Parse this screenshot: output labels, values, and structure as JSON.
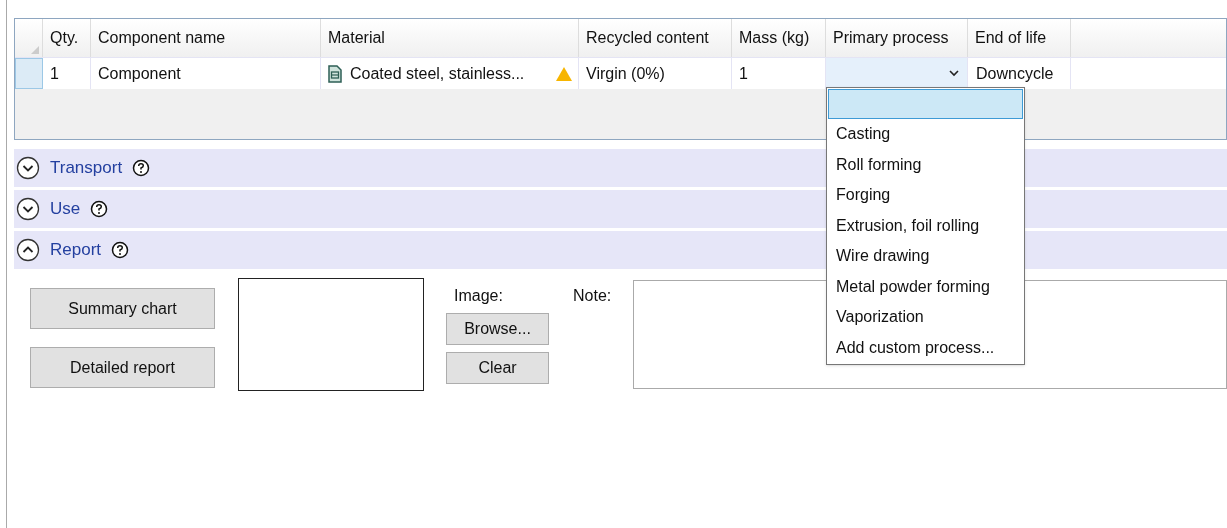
{
  "table": {
    "columns": [
      "Qty.",
      "Component name",
      "Material",
      "Recycled content",
      "Mass (kg)",
      "Primary process",
      "End of life"
    ],
    "rows": [
      {
        "selected": true,
        "qty": "1",
        "name": "Component",
        "material": "Coated steel, stainless...",
        "material_warning": true,
        "recycled": "Virgin (0%)",
        "mass": "1",
        "process": {
          "open": true
        },
        "end_of_life": "Downcycle"
      }
    ]
  },
  "process_dropdown": {
    "blank_option": {
      "selected": true
    },
    "options": [
      {
        "label": "Casting",
        "selected": false
      },
      {
        "label": "Roll forming",
        "selected": false
      },
      {
        "label": "Forging",
        "selected": false
      },
      {
        "label": "Extrusion, foil rolling",
        "selected": false
      },
      {
        "label": "Wire drawing",
        "selected": false
      },
      {
        "label": "Metal powder forming",
        "selected": false
      },
      {
        "label": "Vaporization",
        "selected": false
      },
      {
        "label": "Add custom process...",
        "selected": false
      }
    ]
  },
  "sections": [
    {
      "title": "Transport",
      "expanded": false
    },
    {
      "title": "Use",
      "expanded": false
    },
    {
      "title": "Report",
      "expanded": true
    }
  ],
  "report": {
    "buttons": [
      "Summary chart",
      "Detailed report"
    ],
    "image_label": "Image:",
    "image_buttons": [
      "Browse...",
      "Clear"
    ],
    "note_label": "Note:"
  }
}
